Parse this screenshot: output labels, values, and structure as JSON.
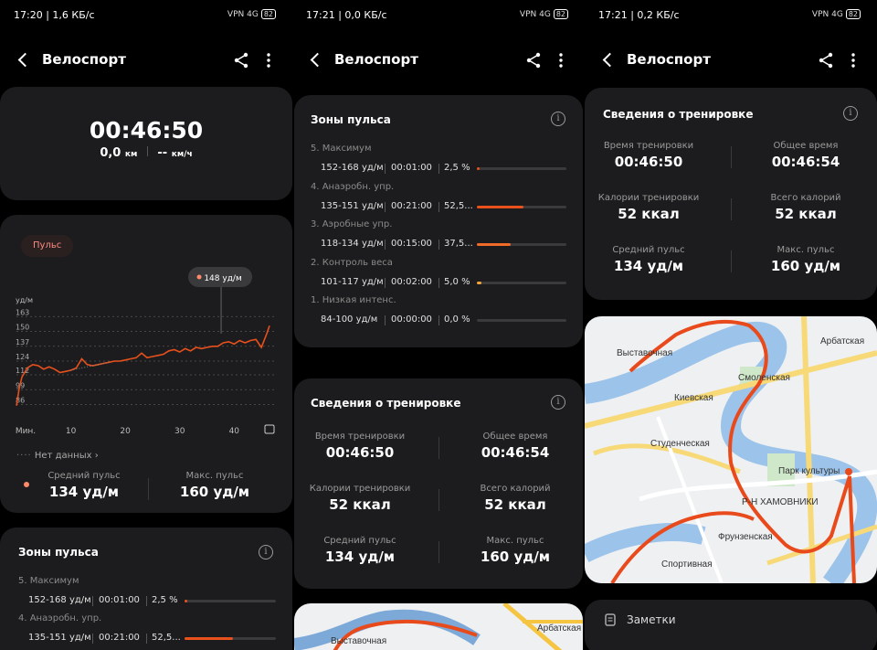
{
  "colors": {
    "accent": "#e8501c",
    "orange": "#f2994a",
    "card": "#1c1c1e",
    "background": "#000000"
  },
  "screens": [
    {
      "status": {
        "time_info": "17:20 | 1,6 КБ/с",
        "right": "VPN 4G",
        "battery": "82"
      },
      "title": "Велоспорт",
      "summary": {
        "duration": "00:46:50",
        "distance": "0,0",
        "distance_unit": "км",
        "speed": "--",
        "speed_unit": "км/ч"
      },
      "chart": {
        "tab": "Пульс",
        "tooltip": "148 уд/м",
        "unit": "уд/м",
        "no_data": "Нет данных",
        "avg_label": "Средний пульс",
        "avg_value": "134 уд/м",
        "max_label": "Макс. пульс",
        "max_value": "160 уд/м"
      },
      "zones_title": "Зоны пульса"
    },
    {
      "status": {
        "time_info": "17:21 | 0,0 КБ/с",
        "right": "VPN 4G",
        "battery": "82"
      },
      "title": "Велоспорт",
      "zones_title": "Зоны пульса",
      "workout_title": "Сведения о тренировке"
    },
    {
      "status": {
        "time_info": "17:21 | 0,2 КБ/с",
        "right": "VPN 4G",
        "battery": "82"
      },
      "title": "Велоспорт",
      "workout_title": "Сведения о тренировке",
      "notes": "Заметки"
    }
  ],
  "workout": [
    {
      "label": "Время тренировки",
      "value": "00:46:50"
    },
    {
      "label": "Общее время",
      "value": "00:46:54"
    },
    {
      "label": "Калории тренировки",
      "value": "52 ккал"
    },
    {
      "label": "Всего калорий",
      "value": "52 ккал"
    },
    {
      "label": "Средний пульс",
      "value": "134 уд/м"
    },
    {
      "label": "Макс. пульс",
      "value": "160 уд/м"
    }
  ],
  "zones": [
    {
      "name": "5. Максимум",
      "range": "152-168 уд/м",
      "time": "00:01:00",
      "pct": "2,5 %",
      "fraction": 0.025,
      "color": "#e8501c"
    },
    {
      "name": "4. Анаэробн. упр.",
      "range": "135-151 уд/м",
      "time": "00:21:00",
      "pct": "52,5...",
      "fraction": 0.525,
      "color": "#e8501c"
    },
    {
      "name": "3. Аэробные упр.",
      "range": "118-134 уд/м",
      "time": "00:15:00",
      "pct": "37,5...",
      "fraction": 0.375,
      "color": "#f06a2a"
    },
    {
      "name": "2. Контроль веса",
      "range": "101-117 уд/м",
      "time": "00:02:00",
      "pct": "5,0 %",
      "fraction": 0.05,
      "color": "#f2a33a"
    },
    {
      "name": "1. Низкая интенс.",
      "range": "84-100 уд/м",
      "time": "00:00:00",
      "pct": "0,0 %",
      "fraction": 0.0,
      "color": "#cccccc"
    }
  ],
  "chart_data": {
    "type": "line",
    "title": "Пульс",
    "ylabel": "уд/м",
    "xlabel": "Мин.",
    "yticks": [
      163,
      150,
      137,
      124,
      112,
      99,
      86
    ],
    "xticks": [
      "Мин.",
      "10",
      "20",
      "30",
      "40"
    ],
    "ylim": [
      80,
      168
    ],
    "xlim": [
      0,
      47
    ],
    "grid": true,
    "series": [
      {
        "x": [
          0,
          0.5,
          1,
          2,
          3,
          4,
          5,
          6,
          7,
          8,
          9,
          10,
          11,
          12,
          13,
          14,
          15,
          16,
          17,
          18,
          19,
          20,
          21,
          22,
          23,
          24,
          25,
          26,
          27,
          28,
          29,
          30,
          31,
          32,
          33,
          34,
          35,
          36,
          37,
          38,
          39,
          40,
          41,
          42,
          43,
          44,
          45,
          46,
          46.5
        ],
        "y": [
          85,
          100,
          110,
          118,
          121,
          120,
          117,
          119,
          117,
          114,
          115,
          116,
          118,
          126,
          121,
          120,
          121,
          122,
          123,
          124,
          124,
          125,
          126,
          127,
          131,
          127,
          128,
          129,
          130,
          133,
          134,
          132,
          135,
          133,
          136,
          135,
          136,
          137,
          137,
          140,
          141,
          139,
          142,
          140,
          142,
          143,
          136,
          148,
          155
        ]
      }
    ]
  },
  "map": {
    "labels": [
      "Выставочная",
      "Арбатская",
      "Смоленская",
      "Киевская",
      "Студенческая",
      "Парк культуры",
      "Р-Н ХАМОВНИКИ",
      "Фрунзенская",
      "Спортивная"
    ]
  }
}
